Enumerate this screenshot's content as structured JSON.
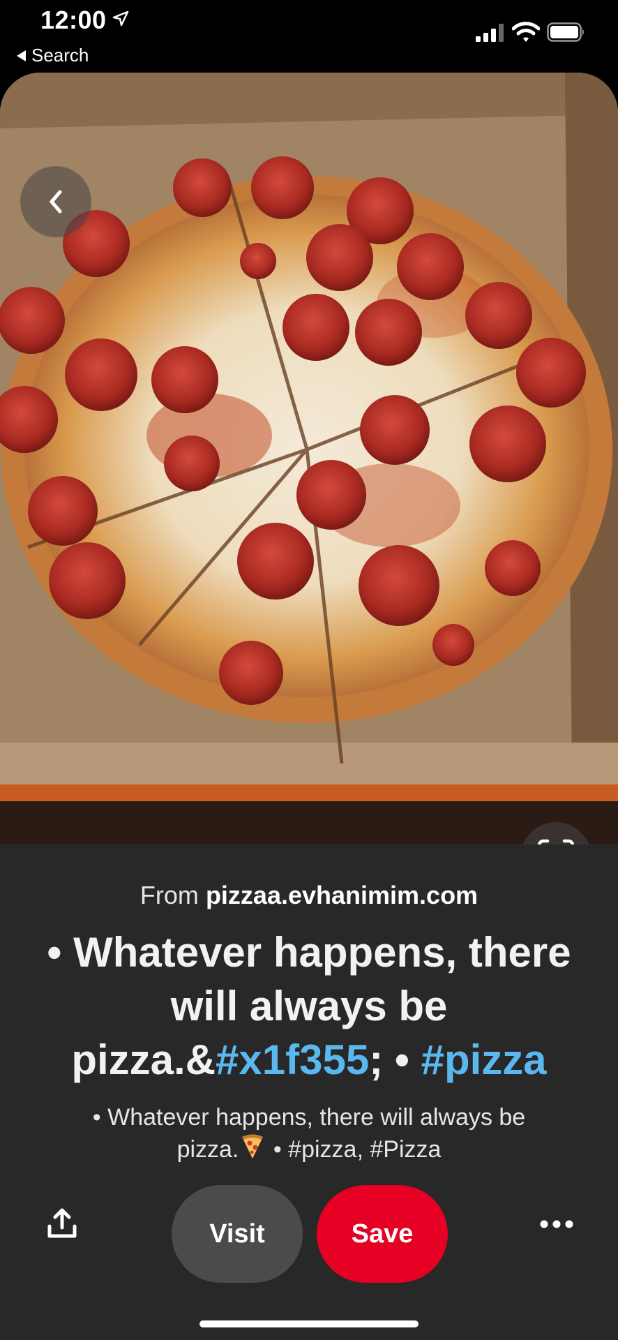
{
  "status_bar": {
    "time": "12:00",
    "back_app_label": "Search"
  },
  "pin": {
    "source_prefix": "From",
    "source_domain": "pizzaa.evhanimim.com",
    "title_text": "• Whatever happens, there will always be pizza.&",
    "title_tag1": "#x1f355",
    "title_mid": "; • ",
    "title_tag2": "#pizza",
    "desc_line1": "• Whatever happens, there will always be",
    "desc_word": "pizza.",
    "desc_tags": " • #pizza, #Pizza"
  },
  "actions": {
    "visit_label": "Visit",
    "save_label": "Save"
  },
  "colors": {
    "accent_red": "#e60023",
    "hashtag_blue": "#5bb8ee",
    "panel_bg": "#282828"
  }
}
